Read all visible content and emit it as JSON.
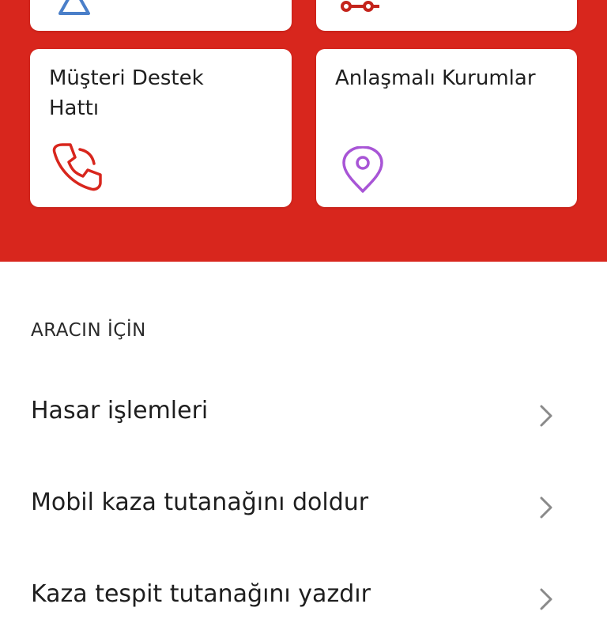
{
  "cards": [
    {
      "label": "Müşteri Destek Hattı",
      "icon": "phone-icon",
      "icon_color": "#d8261d"
    },
    {
      "label": "Anlaşmalı Kurumlar",
      "icon": "location-pin-icon",
      "icon_color": "#a855d6"
    }
  ],
  "top_cards_icons": [
    {
      "icon": "warning-triangle-icon",
      "icon_color": "#4a7fc9"
    },
    {
      "icon": "accident-icon",
      "icon_color": "#c4241c"
    }
  ],
  "section": {
    "title": "ARACIN İÇİN"
  },
  "menu": [
    {
      "label": "Hasar işlemleri"
    },
    {
      "label": "Mobil kaza tutanağını doldur"
    },
    {
      "label": "Kaza tespit tutanağını yazdır"
    }
  ],
  "colors": {
    "primary_red": "#d8261d",
    "text": "#1e1e1e",
    "chevron": "#8a8a8a"
  }
}
